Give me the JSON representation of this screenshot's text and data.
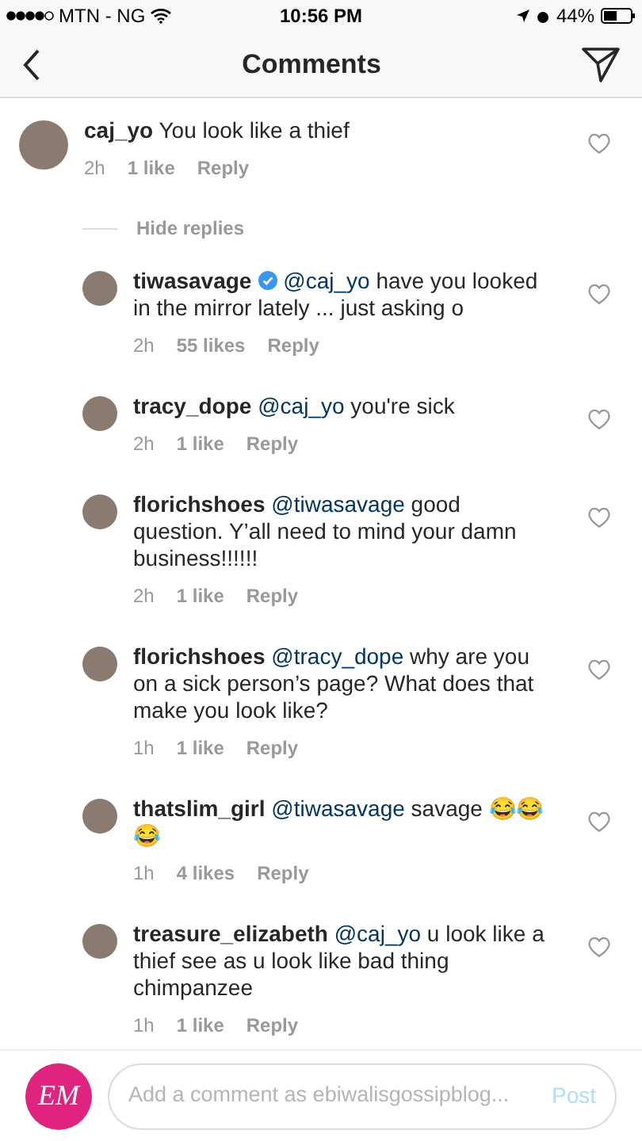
{
  "status_bar": {
    "carrier": "MTN - NG",
    "time": "10:56 PM",
    "battery": "44%"
  },
  "header": {
    "title": "Comments"
  },
  "comments": [
    {
      "username": "caj_yo",
      "verified": false,
      "text": "You look like a thief",
      "time": "2h",
      "likes": "1 like",
      "reply": "Reply",
      "liked": false,
      "replies_toggle": "Hide replies",
      "replies": [
        {
          "username": "tiwasavage",
          "verified": true,
          "mention": "@caj_yo",
          "text": "have you looked in the mirror lately ... just asking o",
          "time": "2h",
          "likes": "55 likes",
          "reply": "Reply",
          "liked": false
        },
        {
          "username": "tracy_dope",
          "verified": false,
          "mention": "@caj_yo",
          "text": "you're sick",
          "time": "2h",
          "likes": "1 like",
          "reply": "Reply",
          "liked": false
        },
        {
          "username": "florichshoes",
          "verified": false,
          "mention": "@tiwasavage",
          "text": "good question. Y’all need to mind your damn business!!!!!!",
          "time": "2h",
          "likes": "1 like",
          "reply": "Reply",
          "liked": false
        },
        {
          "username": "florichshoes",
          "verified": false,
          "mention": "@tracy_dope",
          "text": "why are you on a sick person’s page? What does that make you look like?",
          "time": "1h",
          "likes": "1 like",
          "reply": "Reply",
          "liked": false
        },
        {
          "username": "thatslim_girl",
          "verified": false,
          "mention": "@tiwasavage",
          "text": "savage 😂😂😂",
          "time": "1h",
          "likes": "4 likes",
          "reply": "Reply",
          "liked": false
        },
        {
          "username": "treasure_elizabeth",
          "verified": false,
          "mention": "@caj_yo",
          "text": "u look like a thief see as u look like bad thing chimpanzee",
          "time": "1h",
          "likes": "1 like",
          "reply": "Reply",
          "liked": false
        }
      ]
    }
  ],
  "composer": {
    "logo": "EM",
    "placeholder": "Add a comment as ebiwalisgossipblog...",
    "post": "Post",
    "post_disabled": true
  }
}
